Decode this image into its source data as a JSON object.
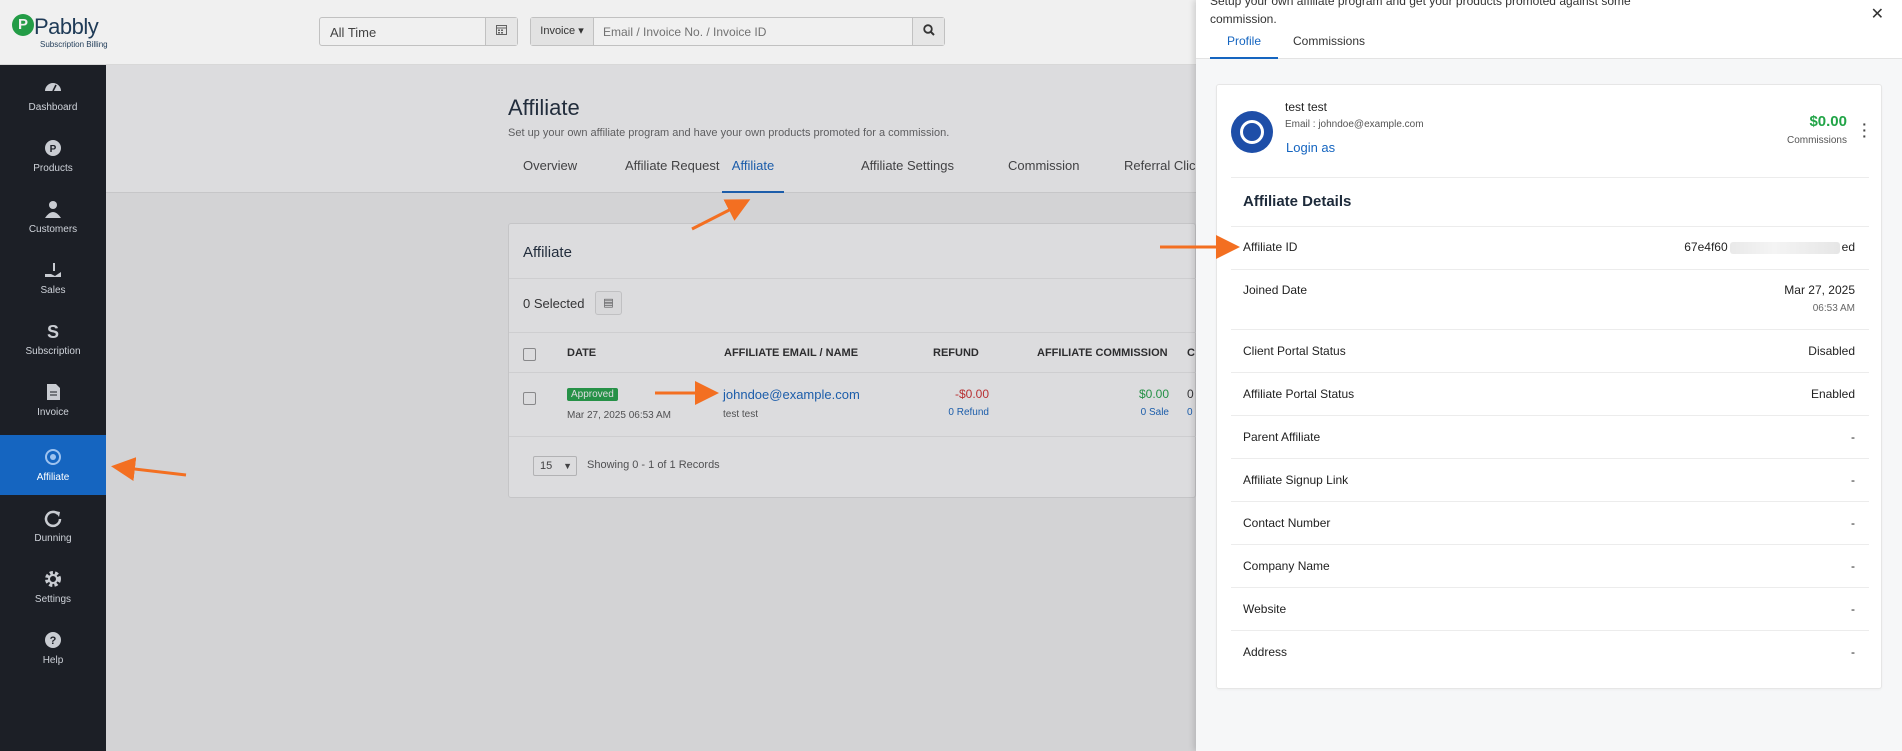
{
  "header": {
    "logo_name": "Pabbly",
    "logo_sub": "Subscription Billing",
    "date_filter": "All Time",
    "search_type": "Invoice",
    "search_placeholder": "Email / Invoice No. / Invoice ID"
  },
  "sidebar": {
    "items": [
      {
        "label": "Dashboard",
        "icon": "dashboard-icon"
      },
      {
        "label": "Products",
        "icon": "products-icon"
      },
      {
        "label": "Customers",
        "icon": "customers-icon"
      },
      {
        "label": "Sales",
        "icon": "sales-icon"
      },
      {
        "label": "Subscription",
        "icon": "subscription-icon"
      },
      {
        "label": "Invoice",
        "icon": "invoice-icon"
      },
      {
        "label": "Affiliate",
        "icon": "affiliate-icon",
        "active": true
      },
      {
        "label": "Dunning",
        "icon": "dunning-icon"
      },
      {
        "label": "Settings",
        "icon": "gear-icon"
      },
      {
        "label": "Help",
        "icon": "help-icon"
      }
    ]
  },
  "main": {
    "title": "Affiliate",
    "subtitle": "Set up your own affiliate program and have your own products promoted for a commission.",
    "tabs": [
      "Overview",
      "Affiliate Request",
      "Affiliate",
      "Affiliate Settings",
      "Commission",
      "Referral Clicks"
    ],
    "active_tab": "Affiliate",
    "card": {
      "title": "Affiliate",
      "selected": "0 Selected",
      "columns": [
        "DATE",
        "AFFILIATE EMAIL / NAME",
        "REFUND",
        "AFFILIATE COMMISSION",
        "C"
      ],
      "row": {
        "status": "Approved",
        "date": "Mar 27, 2025 06:53 AM",
        "email": "johndoe@example.com",
        "name": "test test",
        "refund": "-$0.00",
        "refund_count": "0 Refund",
        "commission": "$0.00",
        "sale_count": "0 Sale",
        "extra1": "0",
        "extra2": "0"
      },
      "page_size": "15",
      "showing": "Showing 0 - 1 of 1 Records"
    }
  },
  "drawer": {
    "description": "Setup your own affiliate program and get your products promoted against some commission.",
    "tabs": [
      "Profile",
      "Commissions"
    ],
    "active_tab": "Profile",
    "profile": {
      "name": "test test",
      "email": "Email : johndoe@example.com",
      "login_as": "Login as",
      "amount": "$0.00",
      "amount_label": "Commissions"
    },
    "details_title": "Affiliate Details",
    "affiliate_id_start": "67e4f60",
    "affiliate_id_end": "ed",
    "details": [
      {
        "label": "Affiliate ID",
        "value": ""
      },
      {
        "label": "Joined Date",
        "value": "Mar 27, 2025",
        "sub": "06:53 AM"
      },
      {
        "label": "Client Portal Status",
        "value": "Disabled"
      },
      {
        "label": "Affiliate Portal Status",
        "value": "Enabled"
      },
      {
        "label": "Parent Affiliate",
        "value": "-"
      },
      {
        "label": "Affiliate Signup Link",
        "value": "-"
      },
      {
        "label": "Contact Number",
        "value": "-"
      },
      {
        "label": "Company Name",
        "value": "-"
      },
      {
        "label": "Website",
        "value": "-"
      },
      {
        "label": "Address",
        "value": "-"
      }
    ]
  },
  "colors": {
    "accent": "#1565c0",
    "success": "#21a447",
    "danger": "#d32f2f",
    "sidebar_bg": "#1c1f26",
    "annotation": "#f36f21"
  }
}
